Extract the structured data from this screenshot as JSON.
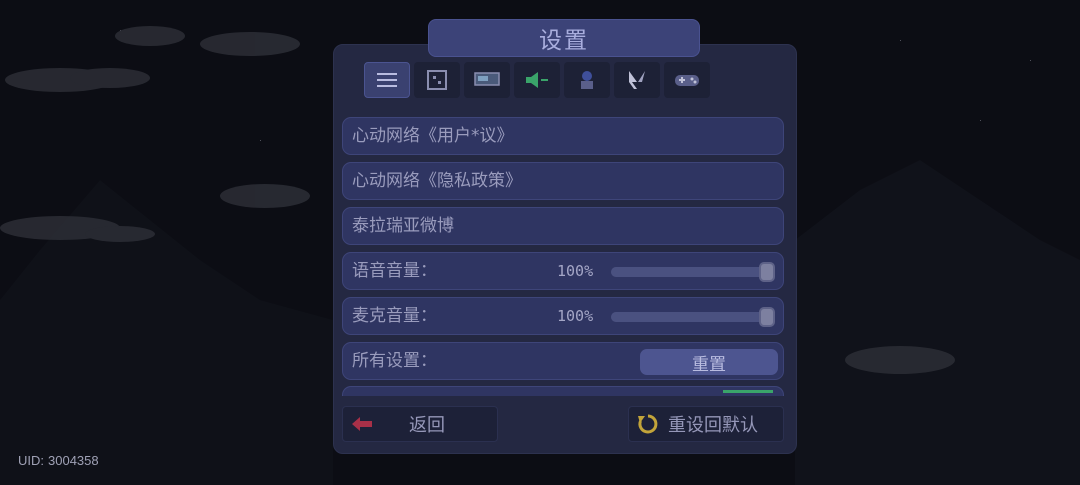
{
  "settings": {
    "title": "设置",
    "tabs": [
      {
        "icon": "menu-icon",
        "active": true
      },
      {
        "icon": "window-icon",
        "active": false
      },
      {
        "icon": "display-icon",
        "active": false
      },
      {
        "icon": "speaker-icon",
        "active": false
      },
      {
        "icon": "character-icon",
        "active": false
      },
      {
        "icon": "cursor-icon",
        "active": false
      },
      {
        "icon": "gamepad-icon",
        "active": false
      }
    ],
    "rows": {
      "user_agreement": "心动网络《用户*议》",
      "privacy_policy": "心动网络《隐私政策》",
      "weibo": "泰拉瑞亚微博",
      "voice_volume": {
        "label": "语音音量：",
        "value_text": "100%",
        "value": 1.0
      },
      "mic_volume": {
        "label": "麦克音量：",
        "value_text": "100%",
        "value": 1.0
      },
      "all_settings": {
        "label": "所有设置：",
        "button": "重置"
      }
    },
    "back_button": "返回",
    "restore_defaults_button": "重设回默认"
  },
  "uid": {
    "label": "UID:",
    "value": "3004358"
  },
  "colors": {
    "panel": "#262a44",
    "row": "#2f3562",
    "title": "#3c4378",
    "back_arrow": "#a83048",
    "restore_icon": "#c2a43a"
  }
}
